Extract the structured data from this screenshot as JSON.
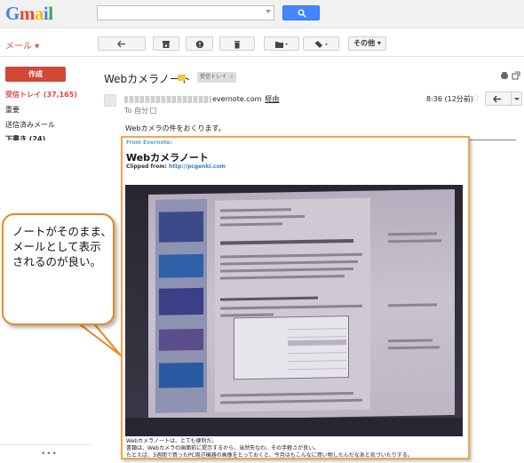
{
  "header": {
    "logo_letters": [
      "G",
      "m",
      "a",
      "i",
      "l"
    ],
    "search_placeholder": ""
  },
  "toolbar": {
    "mail_label": "メール ▾",
    "more_label": "その他 ▾"
  },
  "sidebar": {
    "compose_label": "作成",
    "items": [
      {
        "label": "受信トレイ (37,165)"
      },
      {
        "label": "重要"
      },
      {
        "label": "送信済みメール"
      },
      {
        "label": "下書き (24)"
      }
    ],
    "more": "•••"
  },
  "message": {
    "subject": "Webカメラノート",
    "label_chip": "受信トレイ",
    "label_chip_close": "x",
    "sender_domain": "evernote.com",
    "via": "経由",
    "to": "To 自分",
    "time": "8:36 (12分前)",
    "intro": "Webカメラの件をおくります。"
  },
  "note": {
    "from": "From Evernote:",
    "title": "Webカメラノート",
    "clipped_prefix": "Clipped from: ",
    "clipped_url": "http://pcgenki.com",
    "caption_lines": [
      "Webカメラノートは、とても便利だ。",
      "書類は、Webカメラの画面前に提示するから、当然失なわ、その手軽さが良い。",
      "たとえば、3週間で買ったPC周辺機器の画像をとっておくと、今月はもこんなに買い物したんだなあと気づいたりする。"
    ]
  },
  "callout": {
    "text": "ノートがそのまま、メールとして表示されるのが良い。"
  },
  "colors": {
    "accent_red": "#dd4b39",
    "compose_bg": "#d14836",
    "search_blue": "#4387fd",
    "callout_border": "#e88920",
    "note_frame_border": "#f0a64b"
  }
}
